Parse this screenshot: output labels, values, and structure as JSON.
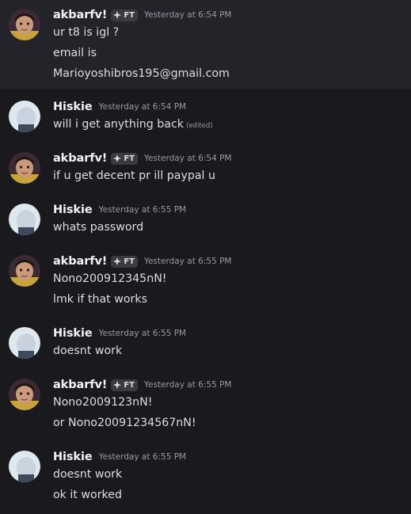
{
  "users": {
    "akbarfv": {
      "name": "akbarfv!",
      "tag": "FT",
      "tag_icon": "diamond-sparkle-icon"
    },
    "hiskie": {
      "name": "Hiskie"
    }
  },
  "messages": [
    {
      "author": "akbarfv!",
      "tag": "FT",
      "timestamp": "Yesterday at 6:54 PM",
      "lines": [
        "ur t8 is igl ?",
        "email is",
        "Marioyoshibros195@gmail.com"
      ]
    },
    {
      "author": "Hiskie",
      "timestamp": "Yesterday at 6:54 PM",
      "lines": [
        "will i get anything back"
      ],
      "edited": "(edited)"
    },
    {
      "author": "akbarfv!",
      "tag": "FT",
      "timestamp": "Yesterday at 6:54 PM",
      "lines": [
        "if u get decent pr ill paypal u"
      ]
    },
    {
      "author": "Hiskie",
      "timestamp": "Yesterday at 6:55 PM",
      "lines": [
        "whats password"
      ]
    },
    {
      "author": "akbarfv!",
      "tag": "FT",
      "timestamp": "Yesterday at 6:55 PM",
      "lines": [
        "Nono200912345nN!",
        "lmk if that works"
      ]
    },
    {
      "author": "Hiskie",
      "timestamp": "Yesterday at 6:55 PM",
      "lines": [
        "doesnt work"
      ]
    },
    {
      "author": "akbarfv!",
      "tag": "FT",
      "timestamp": "Yesterday at 6:55 PM",
      "lines": [
        "Nono2009123nN!",
        "or Nono20091234567nN!"
      ]
    },
    {
      "author": "Hiskie",
      "timestamp": "Yesterday at 6:55 PM",
      "lines": [
        "doesnt work",
        "ok it worked"
      ]
    }
  ],
  "colors": {
    "background": "#1a1a1e",
    "hover_background": "#232329",
    "username": "#f2f3f5",
    "message_text": "#dbdee1",
    "timestamp": "#949ba4",
    "tag_background": "#3a3b41"
  }
}
